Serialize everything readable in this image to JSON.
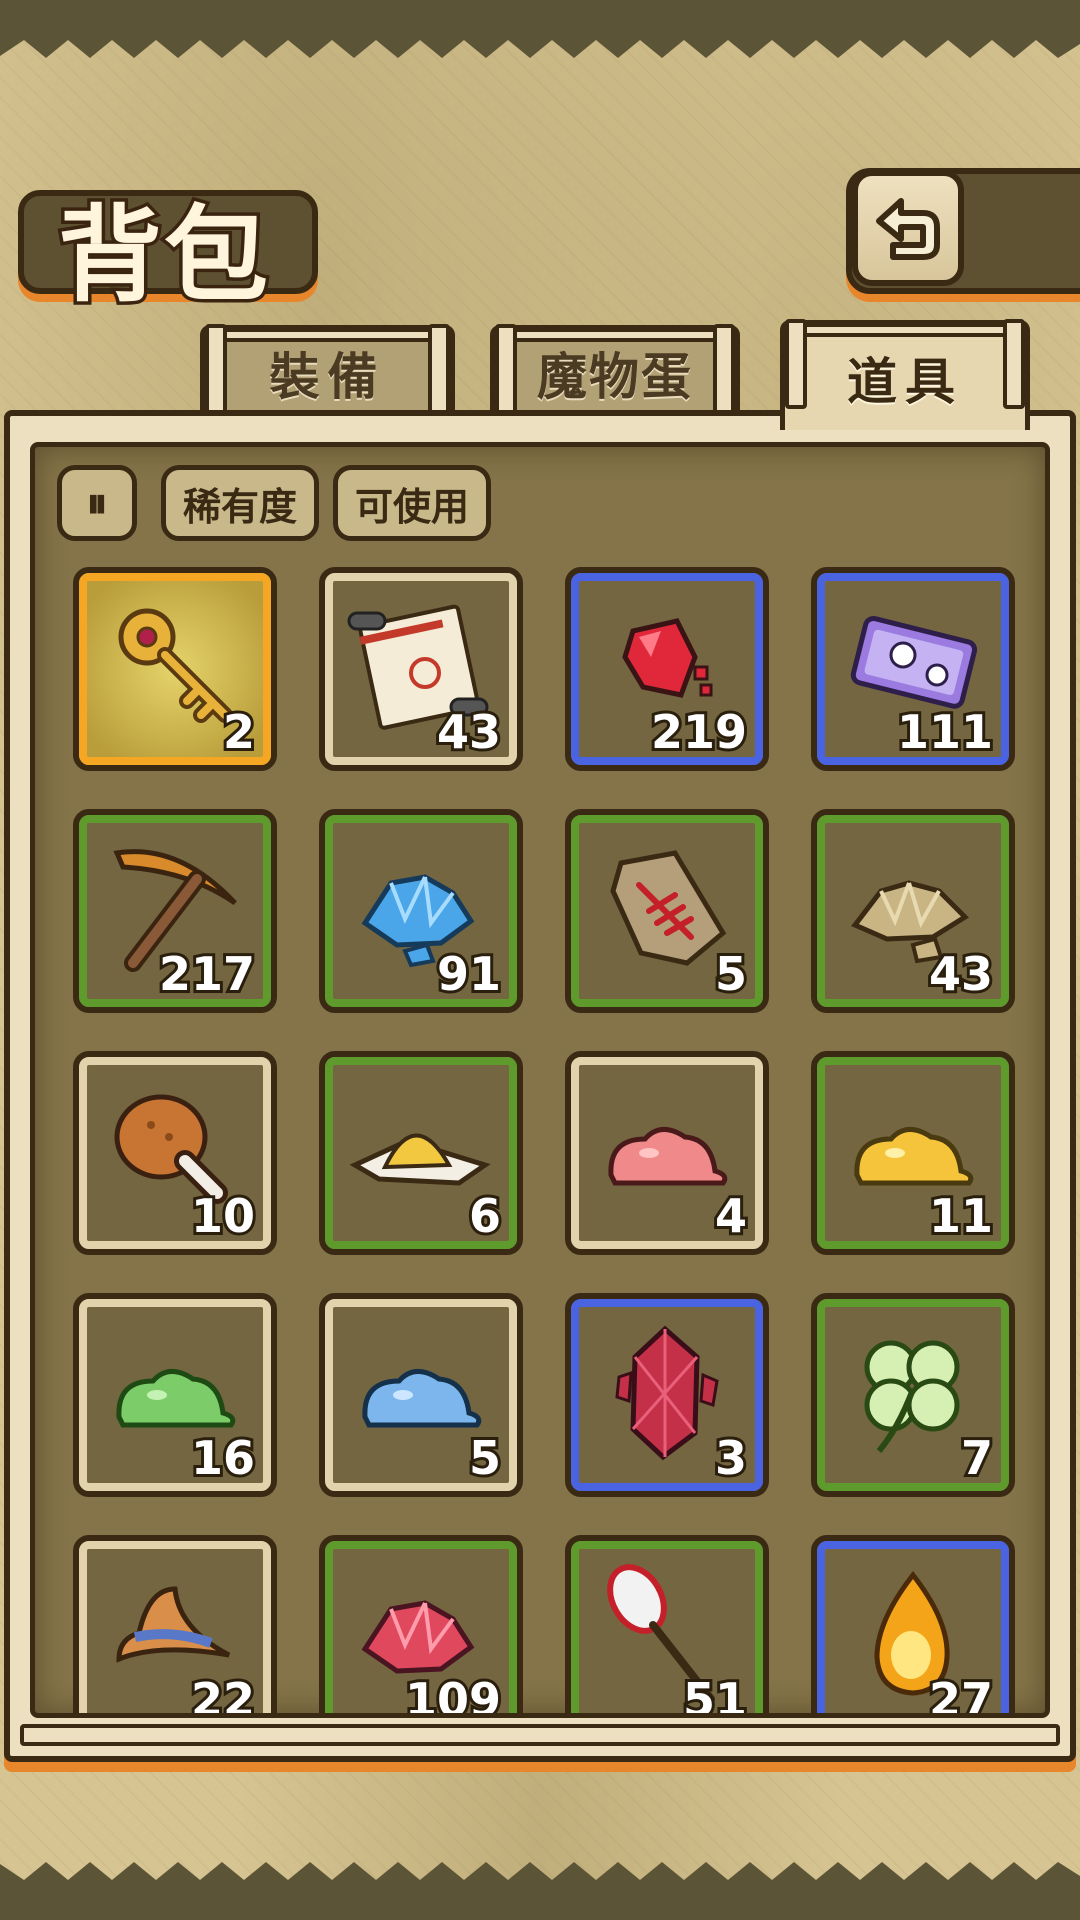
{
  "header": {
    "title": "背包",
    "back_button": "return-icon"
  },
  "tabs": [
    {
      "label": "裝備",
      "active": false
    },
    {
      "label": "魔物蛋",
      "active": false
    },
    {
      "label": "道具",
      "active": true
    }
  ],
  "filters": {
    "sort_icon": "sort-icon",
    "sort_glyph": "⏸",
    "rarity_label": "稀有度",
    "usable_label": "可使用"
  },
  "rarity_colors": {
    "legendary": "#f5a623",
    "rare": "#4a63e0",
    "uncommon": "#5e9a2c",
    "common": "#e3d3ac"
  },
  "items": [
    {
      "icon": "golden-key-icon",
      "count": "2",
      "rarity": "legendary"
    },
    {
      "icon": "scroll-icon",
      "count": "43",
      "rarity": "common"
    },
    {
      "icon": "red-gem-icon",
      "count": "219",
      "rarity": "rare"
    },
    {
      "icon": "purple-ticket-icon",
      "count": "111",
      "rarity": "rare"
    },
    {
      "icon": "pickaxe-icon",
      "count": "217",
      "rarity": "uncommon"
    },
    {
      "icon": "blue-crystals-icon",
      "count": "91",
      "rarity": "uncommon"
    },
    {
      "icon": "fish-tag-icon",
      "count": "5",
      "rarity": "uncommon"
    },
    {
      "icon": "ore-pile-icon",
      "count": "43",
      "rarity": "uncommon"
    },
    {
      "icon": "drumstick-icon",
      "count": "10",
      "rarity": "common"
    },
    {
      "icon": "yellow-powder-icon",
      "count": "6",
      "rarity": "uncommon"
    },
    {
      "icon": "pink-slime-icon",
      "count": "4",
      "rarity": "common"
    },
    {
      "icon": "yellow-slime-icon",
      "count": "11",
      "rarity": "uncommon"
    },
    {
      "icon": "green-slime-icon",
      "count": "16",
      "rarity": "common"
    },
    {
      "icon": "blue-slime-icon",
      "count": "5",
      "rarity": "common"
    },
    {
      "icon": "red-crystal-icon",
      "count": "3",
      "rarity": "rare"
    },
    {
      "icon": "four-leaf-clover-icon",
      "count": "7",
      "rarity": "uncommon"
    },
    {
      "icon": "witch-hat-icon",
      "count": "22",
      "rarity": "common"
    },
    {
      "icon": "pink-crystals-icon",
      "count": "109",
      "rarity": "uncommon"
    },
    {
      "icon": "net-icon",
      "count": "51",
      "rarity": "uncommon"
    },
    {
      "icon": "fire-drop-icon",
      "count": "27",
      "rarity": "rare"
    }
  ]
}
